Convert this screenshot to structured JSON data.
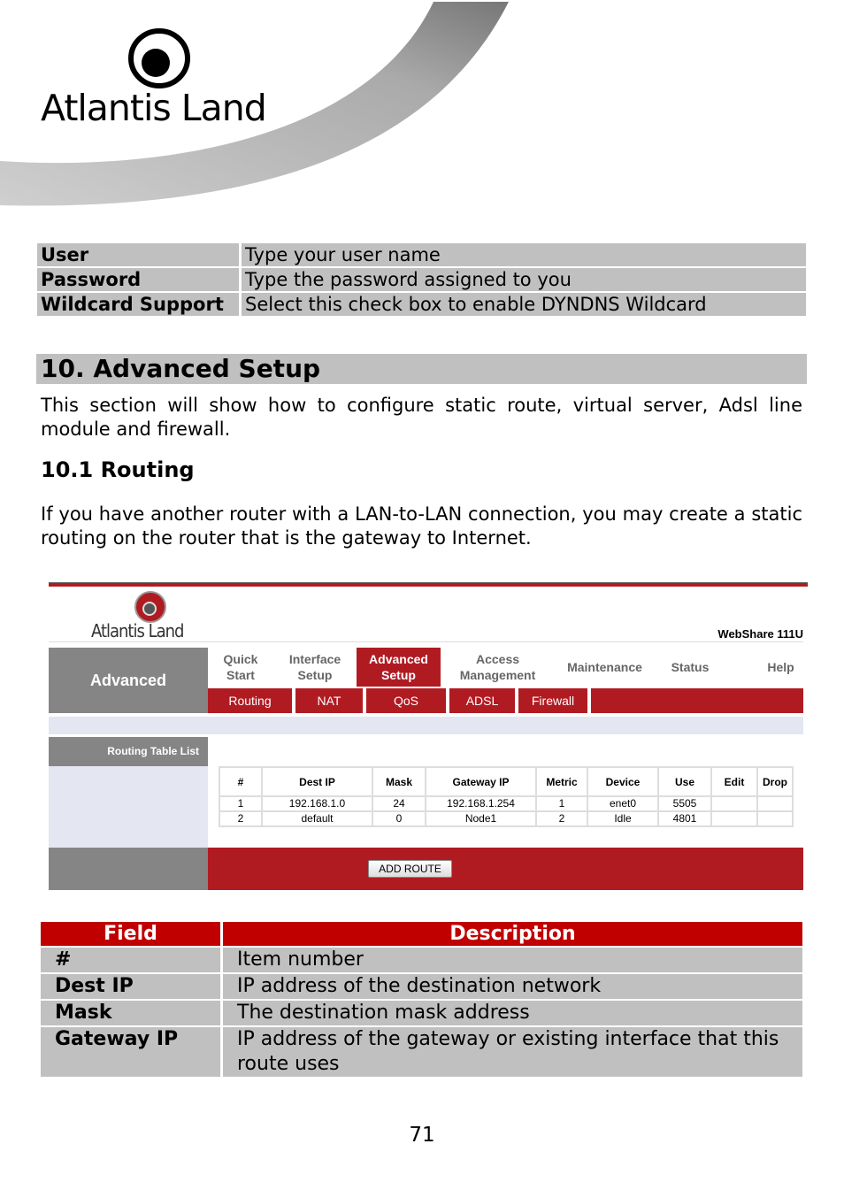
{
  "header": {
    "logo_text": "Atlantis Land"
  },
  "settings_table": [
    {
      "field": "User",
      "description": "Type your user name"
    },
    {
      "field": "Password",
      "description": "Type the password assigned to you"
    },
    {
      "field": "Wildcard Support",
      "description": "Select this check box to enable DYNDNS Wildcard"
    }
  ],
  "section": {
    "title": "10. Advanced Setup",
    "intro": "This section will show how to configure static route, virtual server, Adsl line module and firewall.",
    "subtitle": "10.1 Routing",
    "subintro": "If you have another router with a LAN-to-LAN connection, you may create a static routing on the router that is the gateway to Internet."
  },
  "router_ui": {
    "brand": "Atlantis Land",
    "model": "WebShare 111U",
    "left_nav": "Advanced",
    "menu": [
      {
        "label": "Quick Start",
        "active": false
      },
      {
        "label": "Interface Setup",
        "active": false
      },
      {
        "label": "Advanced Setup",
        "active": true
      },
      {
        "label": "Access Management",
        "active": false
      },
      {
        "label": "Maintenance",
        "active": false
      },
      {
        "label": "Status",
        "active": false
      },
      {
        "label": "Help",
        "active": false
      }
    ],
    "submenu": [
      "Routing",
      "NAT",
      "QoS",
      "ADSL",
      "Firewall"
    ],
    "section_label": "Routing Table List",
    "table": {
      "headers": [
        "#",
        "Dest IP",
        "Mask",
        "Gateway IP",
        "Metric",
        "Device",
        "Use",
        "Edit",
        "Drop"
      ],
      "rows": [
        [
          "1",
          "192.168.1.0",
          "24",
          "192.168.1.254",
          "1",
          "enet0",
          "5505",
          "",
          ""
        ],
        [
          "2",
          "default",
          "0",
          "Node1",
          "2",
          "Idle",
          "4801",
          "",
          ""
        ]
      ]
    },
    "add_button": "ADD ROUTE",
    "accent": "#b01b22"
  },
  "field_table": {
    "headers": [
      "Field",
      "Description"
    ],
    "rows": [
      {
        "field": "#",
        "description": "Item number"
      },
      {
        "field": "Dest IP",
        "description": "IP address of the destination network"
      },
      {
        "field": "Mask",
        "description": "The destination mask address"
      },
      {
        "field": "Gateway IP",
        "description": "IP address of the gateway or existing interface that this route uses"
      }
    ],
    "header_color": "#c00000"
  },
  "page_number": "71"
}
